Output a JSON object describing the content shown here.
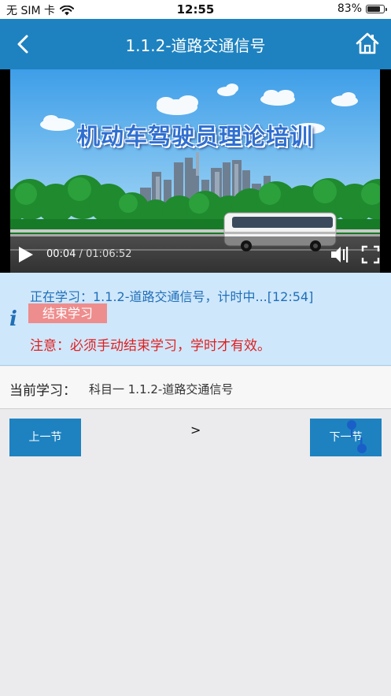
{
  "status_bar": {
    "carrier": "无 SIM 卡",
    "time": "12:55",
    "battery": "83%",
    "battery_level": 0.83
  },
  "header": {
    "title": "1.1.2-道路交通信号",
    "back_icon": "chevron-left-icon",
    "home_icon": "home-icon"
  },
  "video": {
    "title_text": "机动车驾驶员理论培训",
    "current_time": "00:04",
    "separator": " / ",
    "duration": "01:06:52"
  },
  "info": {
    "status_text": "正在学习：1.1.2-道路交通信号，计时中...[12:54]",
    "end_button": "结束学习",
    "note": "注意：必须手动结束学习，学时才有效。",
    "accent_color": "#1f6fb8",
    "warning_color": "#e02020"
  },
  "current": {
    "label": "当前学习：",
    "value": "科目一 1.1.2-道路交通信号"
  },
  "navigation": {
    "prev_label": "上一节",
    "next_label": "下一节",
    "center_mark": ">"
  },
  "colors": {
    "brand": "#1e82c0",
    "info_bg": "#cfe7fb",
    "end_button_bg": "#ee8d8d"
  }
}
